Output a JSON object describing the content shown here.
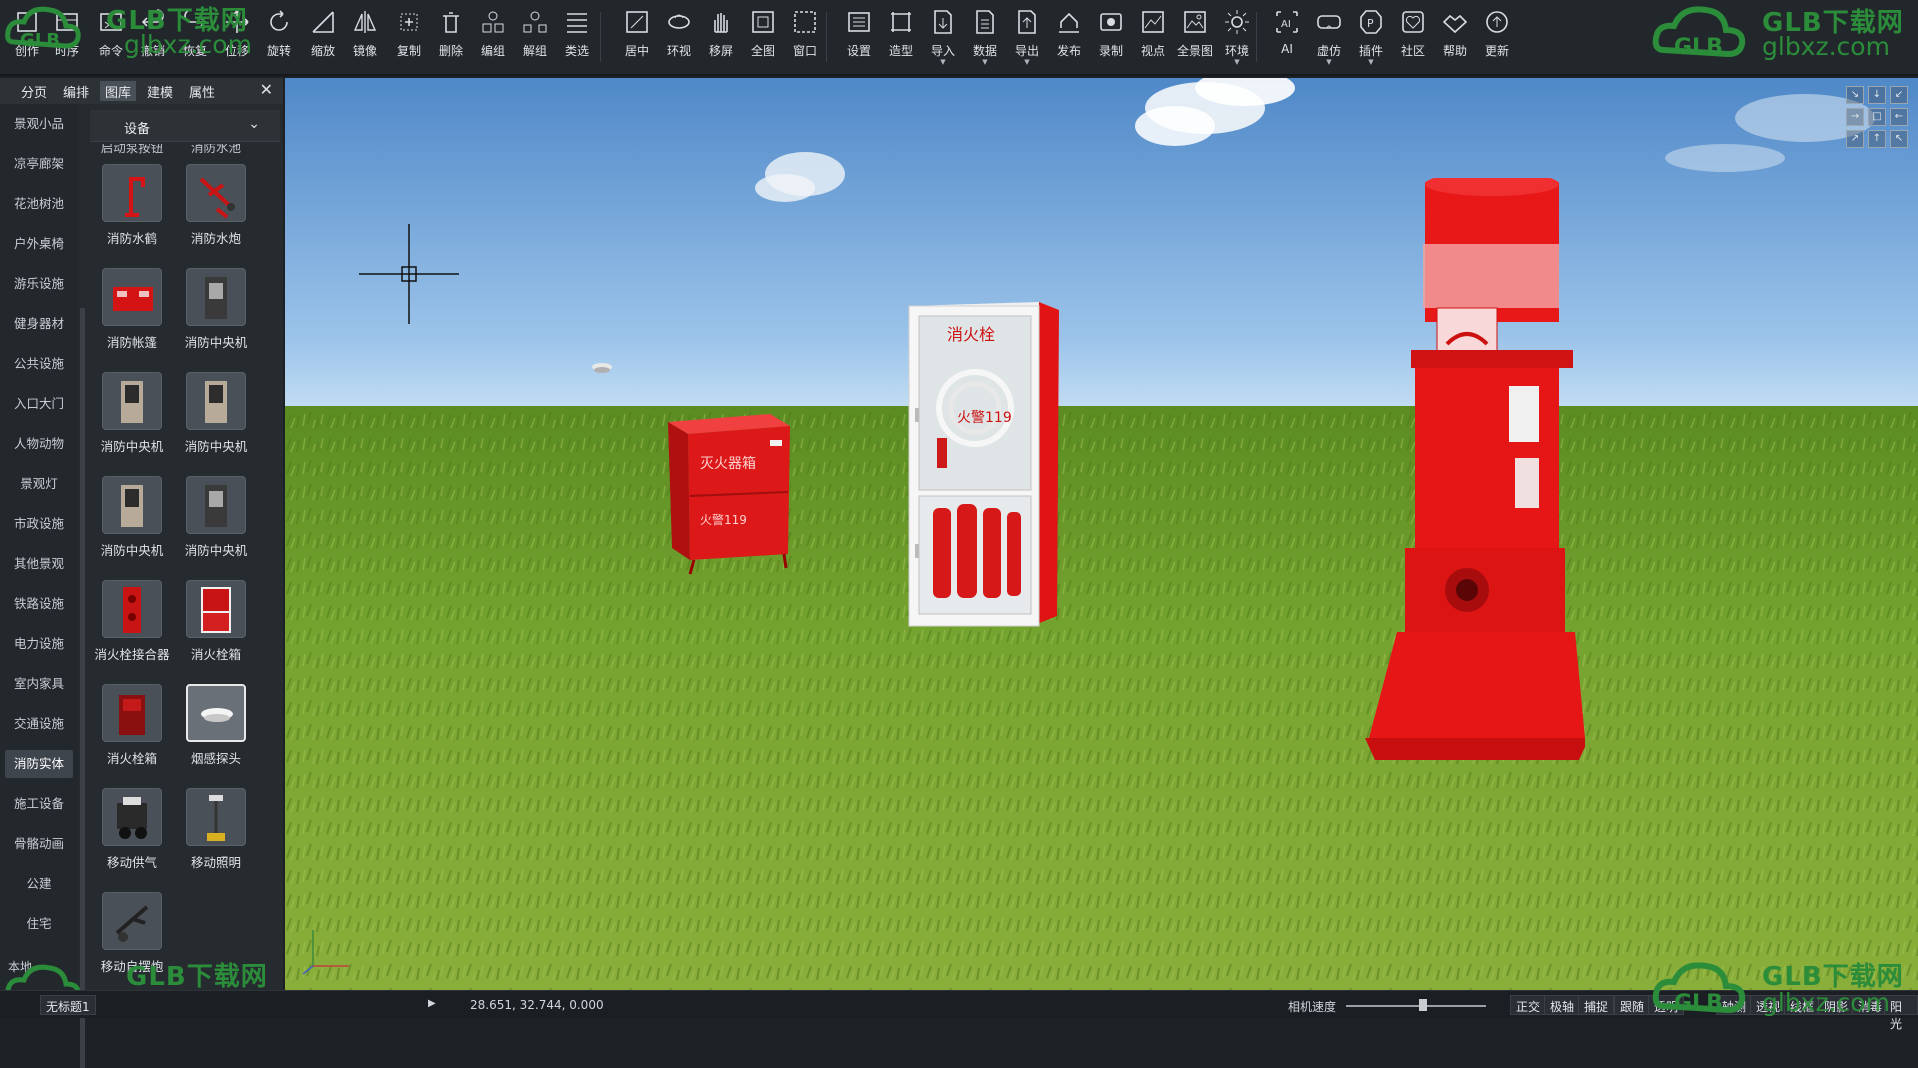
{
  "toolbar": {
    "items": [
      {
        "label": "创作",
        "icon": "create-icon"
      },
      {
        "label": "时序",
        "icon": "timeline-icon"
      },
      {
        "label": "命令",
        "icon": "command-icon"
      },
      {
        "label": "撤销",
        "icon": "undo-icon"
      },
      {
        "label": "恢复",
        "icon": "redo-icon"
      },
      {
        "label": "位移",
        "icon": "move-icon"
      },
      {
        "label": "旋转",
        "icon": "rotate-icon"
      },
      {
        "label": "缩放",
        "icon": "scale-icon"
      },
      {
        "label": "镜像",
        "icon": "mirror-icon"
      },
      {
        "label": "复制",
        "icon": "copy-icon"
      },
      {
        "label": "删除",
        "icon": "delete-icon"
      },
      {
        "label": "编组",
        "icon": "group-icon"
      },
      {
        "label": "解组",
        "icon": "ungroup-icon"
      },
      {
        "label": "类选",
        "icon": "class-select-icon"
      },
      {
        "label": "居中",
        "icon": "center-icon"
      },
      {
        "label": "环视",
        "icon": "orbit-icon"
      },
      {
        "label": "移屏",
        "icon": "pan-icon"
      },
      {
        "label": "全图",
        "icon": "fit-all-icon"
      },
      {
        "label": "窗口",
        "icon": "window-zoom-icon"
      },
      {
        "label": "设置",
        "icon": "settings-icon"
      },
      {
        "label": "造型",
        "icon": "modeling-icon"
      },
      {
        "label": "导入",
        "icon": "import-icon"
      },
      {
        "label": "数据",
        "icon": "data-icon"
      },
      {
        "label": "导出",
        "icon": "export-icon"
      },
      {
        "label": "发布",
        "icon": "publish-icon"
      },
      {
        "label": "录制",
        "icon": "record-icon"
      },
      {
        "label": "视点",
        "icon": "viewpoint-icon"
      },
      {
        "label": "全景图",
        "icon": "panorama-icon"
      },
      {
        "label": "环境",
        "icon": "environment-icon"
      },
      {
        "label": "AI",
        "icon": "ai-icon"
      },
      {
        "label": "虚仿",
        "icon": "vr-icon"
      },
      {
        "label": "插件",
        "icon": "plugin-icon"
      },
      {
        "label": "社区",
        "icon": "community-icon"
      },
      {
        "label": "帮助",
        "icon": "help-icon"
      },
      {
        "label": "更新",
        "icon": "update-icon"
      }
    ]
  },
  "watermark": {
    "brand": "GLB下载网",
    "url": "glbxz.com",
    "logo": "GLB"
  },
  "panel": {
    "tabs": [
      "分页",
      "编排",
      "图库",
      "建模",
      "属性"
    ],
    "active_tab": "图库",
    "close": "✕",
    "categories": [
      "景观小品",
      "凉亭廊架",
      "花池树池",
      "户外桌椅",
      "游乐设施",
      "健身器材",
      "公共设施",
      "入口大门",
      "人物动物",
      "景观灯",
      "市政设施",
      "其他景观",
      "铁路设施",
      "电力设施",
      "室内家具",
      "交通设施",
      "消防实体",
      "施工设备",
      "骨骼动画",
      "公建",
      "住宅"
    ],
    "active_category": "消防实体",
    "local_label": "本地",
    "dropdown": {
      "value": "设备",
      "arrow": "⌄"
    },
    "partial_labels": [
      "启动泵按钮",
      "消防水池"
    ],
    "items": [
      {
        "name": "消防水鹤",
        "kind": "crane"
      },
      {
        "name": "消防水炮",
        "kind": "cannon"
      },
      {
        "name": "消防帐篷",
        "kind": "tent"
      },
      {
        "name": "消防中央机",
        "kind": "cabinet-dark"
      },
      {
        "name": "消防中央机",
        "kind": "cabinet"
      },
      {
        "name": "消防中央机",
        "kind": "cabinet"
      },
      {
        "name": "消防中央机",
        "kind": "cabinet"
      },
      {
        "name": "消防中央机",
        "kind": "cabinet-dark"
      },
      {
        "name": "消火栓接合器",
        "kind": "connector"
      },
      {
        "name": "消火栓箱",
        "kind": "hydrant-box"
      },
      {
        "name": "消火栓箱",
        "kind": "hydrant-box-dark"
      },
      {
        "name": "烟感探头",
        "kind": "smoke-detector"
      },
      {
        "name": "移动供气",
        "kind": "air-supply"
      },
      {
        "name": "移动照明",
        "kind": "lighting"
      },
      {
        "name": "移动自摆炮",
        "kind": "cannon-mobile"
      }
    ],
    "selected_index": 11
  },
  "viewport": {
    "cam_buttons": [
      "↘",
      "↓",
      "↙",
      "→",
      "□",
      "←",
      "↗",
      "↑",
      "↖"
    ],
    "colors": {
      "sky": "#6aa2dc",
      "grass": "#6f9c2c",
      "fire_red": "#e01414"
    },
    "objects": [
      {
        "name": "灭火器箱",
        "label": "灭火器箱",
        "label2": "火警119"
      },
      {
        "name": "消火栓箱",
        "label": "消火栓",
        "label2": "火警119"
      },
      {
        "name": "消防泵",
        "label": ""
      }
    ]
  },
  "status": {
    "doc_name": "无标题1",
    "play": "▶",
    "coords": "28.651, 32.744, 0.000",
    "camera_speed_label": "相机速度",
    "camera_speed": 0.55,
    "toggles": [
      "正交",
      "极轴",
      "捕捉",
      "跟随",
      "透明",
      "轴测",
      "透视",
      "线框",
      "阴影",
      "消毒",
      "阳光"
    ]
  }
}
